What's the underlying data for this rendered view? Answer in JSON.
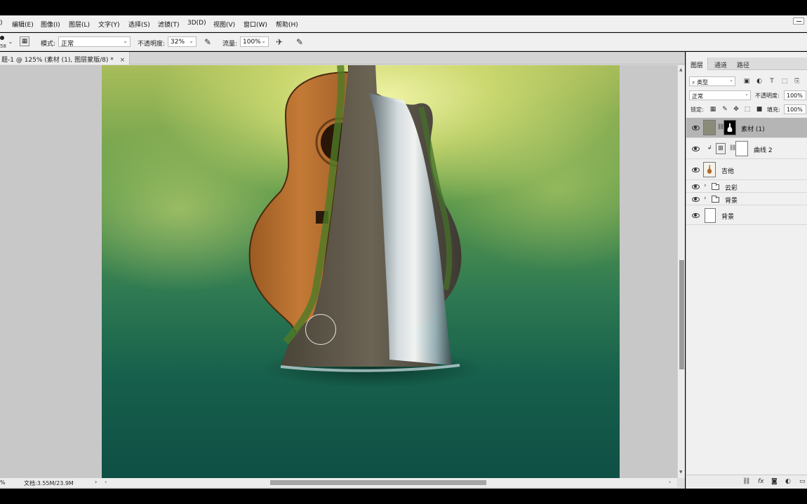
{
  "menu": [
    "编辑(E)",
    "图像(I)",
    "图层(L)",
    "文字(Y)",
    "选择(S)",
    "滤镜(T)",
    "3D(D)",
    "视图(V)",
    "窗口(W)",
    "帮助(H)"
  ],
  "menu_prefix": ")",
  "options": {
    "brush_size": "58",
    "mode_label": "模式:",
    "mode_value": "正常",
    "opacity_label": "不透明度:",
    "opacity_value": "32%",
    "flow_label": "流量:",
    "flow_value": "100%"
  },
  "document_tab": {
    "title": "题-1 @ 125% (素材 (1), 图层蒙版/8) *",
    "close": "×"
  },
  "status": {
    "zoom": "%",
    "doc": "文档:3.55M/23.9M",
    "arrow": "›"
  },
  "layers_panel": {
    "tabs": [
      "图层",
      "通道",
      "路径"
    ],
    "filter_kind": "类型",
    "blend_mode": "正常",
    "opacity_label": "不透明度:",
    "opacity_value": "100%",
    "lock_label": "锁定:",
    "fill_label": "填充:",
    "fill_value": "100%",
    "layers": [
      {
        "name": "素材 (1)",
        "selected": true
      },
      {
        "name": "曲线 2",
        "selected": false
      },
      {
        "name": "吉他",
        "selected": false
      },
      {
        "name": "云彩",
        "selected": false
      },
      {
        "name": "背景",
        "selected": false
      },
      {
        "name": "背景",
        "selected": false
      }
    ],
    "footer_fx": "fx"
  },
  "colors": {
    "selected_layer": "#b5b5b5",
    "panel_bg": "#f0f0f0",
    "canvas_top": "#f4f6aa",
    "canvas_bottom": "#0f4f44"
  }
}
